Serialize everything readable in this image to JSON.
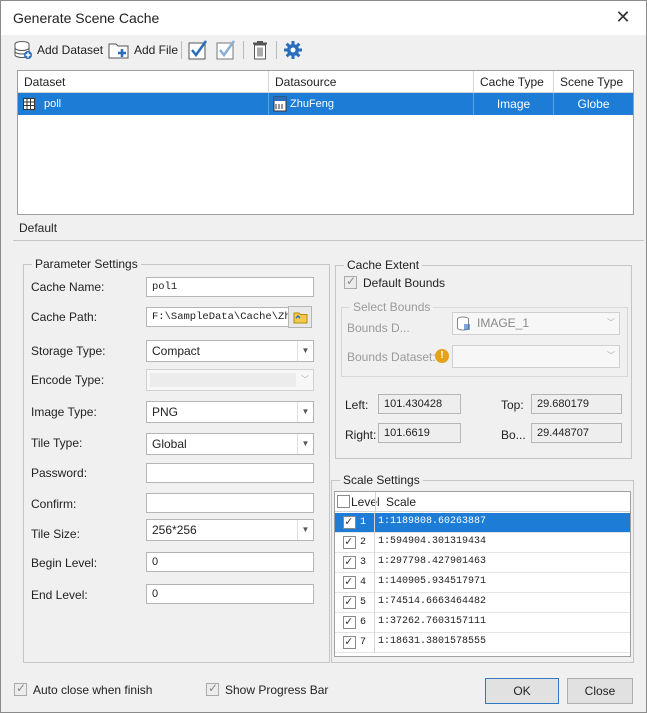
{
  "window": {
    "title": "Generate Scene Cache"
  },
  "toolbar": {
    "add_dataset": "Add Dataset",
    "add_file": "Add File"
  },
  "grid": {
    "headers": {
      "dataset": "Dataset",
      "datasource": "Datasource",
      "cache_type": "Cache Type",
      "scene_type": "Scene Type"
    },
    "rows": [
      {
        "dataset": "poll",
        "datasource": "ZhuFeng",
        "cache_type": "Image",
        "scene_type": "Globe"
      }
    ]
  },
  "tabs": {
    "default": "Default"
  },
  "params": {
    "group": "Parameter Settings",
    "cache_name_label": "Cache Name:",
    "cache_name": "pol1",
    "cache_path_label": "Cache Path:",
    "cache_path": "F:\\SampleData\\Cache\\Zhufeng",
    "storage_type_label": "Storage Type:",
    "storage_type": "Compact",
    "encode_type_label": "Encode Type:",
    "image_type_label": "Image Type:",
    "image_type": "PNG",
    "tile_type_label": "Tile Type:",
    "tile_type": "Global",
    "password_label": "Password:",
    "confirm_label": "Confirm:",
    "tile_size_label": "Tile Size:",
    "tile_size": "256*256",
    "begin_level_label": "Begin Level:",
    "begin_level": "0",
    "end_level_label": "End Level:",
    "end_level": "0"
  },
  "extent": {
    "group": "Cache Extent",
    "default_bounds": "Default Bounds",
    "select_bounds": "Select Bounds",
    "bounds_d_label": "Bounds D...",
    "bounds_d_value": "IMAGE_1",
    "bounds_dataset_label": "Bounds Dataset:",
    "left_label": "Left:",
    "left": "101.430428",
    "top_label": "Top:",
    "top": "29.680179",
    "right_label": "Right:",
    "right": "101.6619",
    "bottom_label": "Bo...",
    "bottom": "29.448707"
  },
  "scale": {
    "group": "Scale Settings",
    "level_header": "Level",
    "scale_header": "Scale",
    "rows": [
      {
        "level": "1",
        "scale": "1:1189808.60263887"
      },
      {
        "level": "2",
        "scale": "1:594904.301319434"
      },
      {
        "level": "3",
        "scale": "1:297798.427901463"
      },
      {
        "level": "4",
        "scale": "1:140905.934517971"
      },
      {
        "level": "5",
        "scale": "1:74514.6663464482"
      },
      {
        "level": "6",
        "scale": "1:37262.7603157111"
      },
      {
        "level": "7",
        "scale": "1:18631.3801578555"
      }
    ]
  },
  "footer": {
    "auto_close": "Auto close when finish",
    "show_progress": "Show Progress Bar",
    "ok": "OK",
    "close": "Close"
  },
  "colors": {
    "selection": "#1c7cd6",
    "icon_blue": "#2a6ebb"
  }
}
